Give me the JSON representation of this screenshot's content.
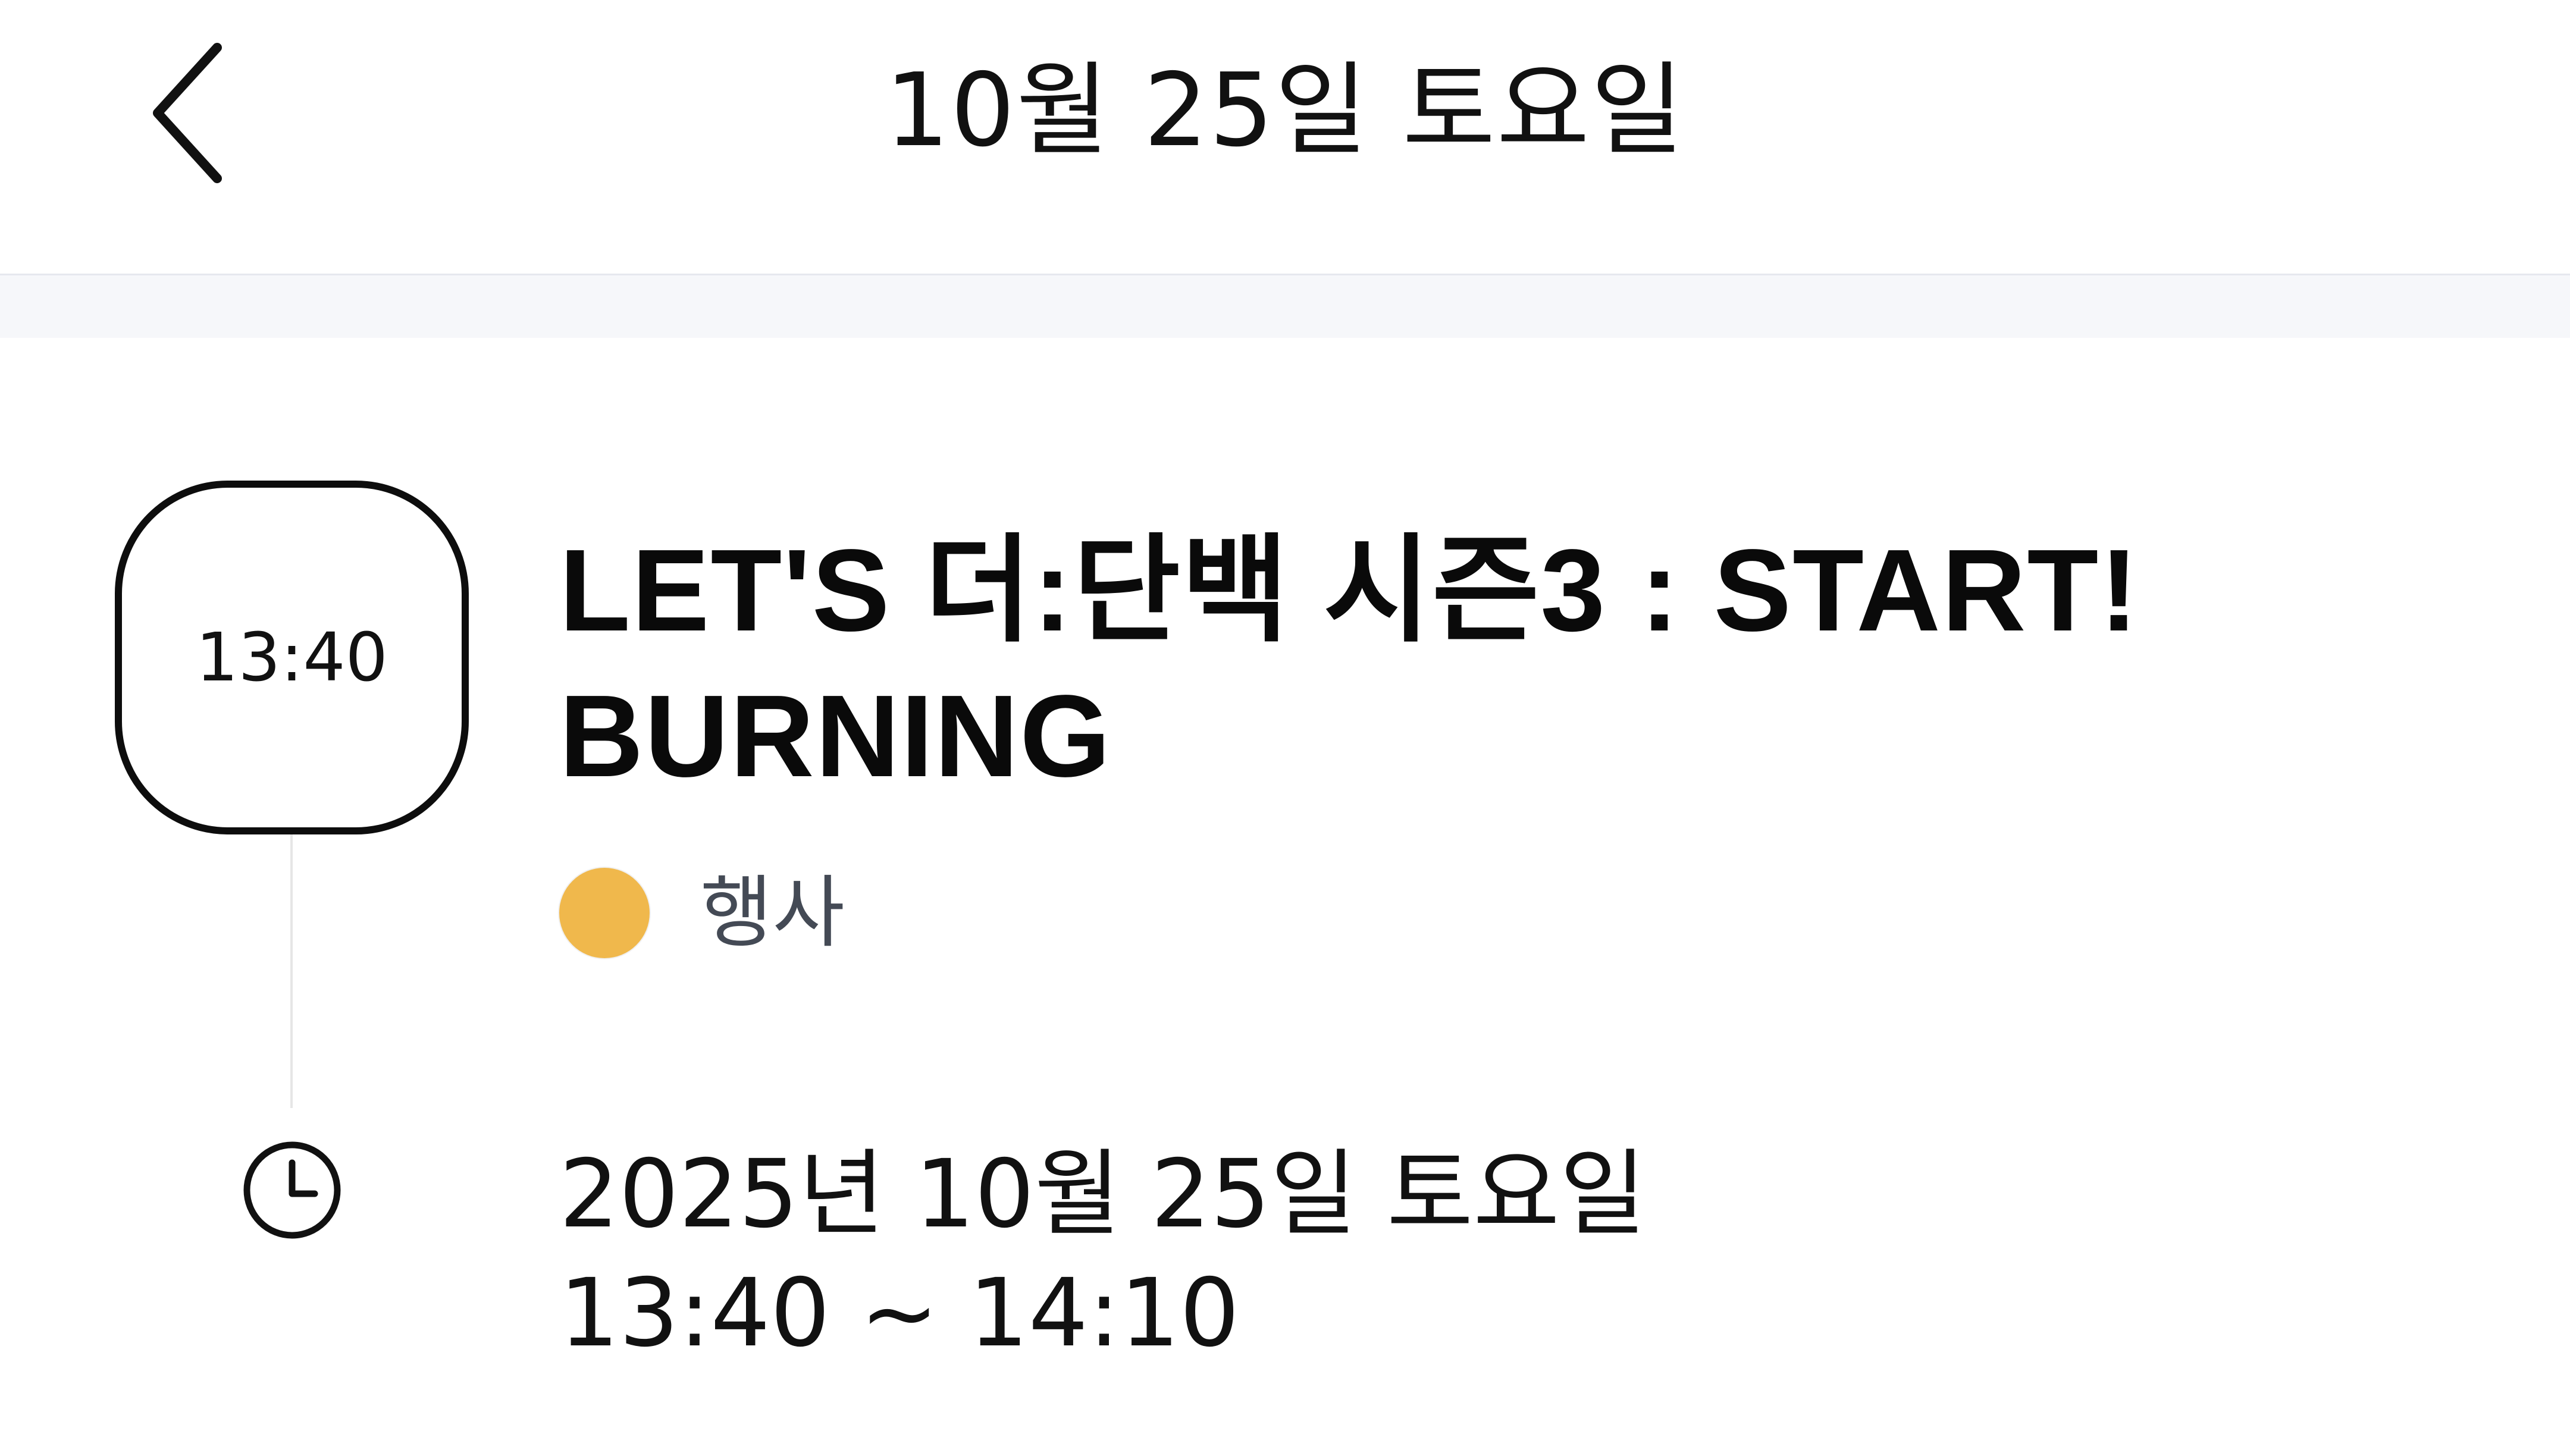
{
  "header": {
    "title": "10월 25일 토요일",
    "back_icon": "chevron-left-icon"
  },
  "event": {
    "time_badge": "13:40",
    "title_line1": "LET'S 더:단백 시즌3 : START!",
    "title_line2": "BURNING",
    "category": {
      "label": "행사",
      "color": "#F0B84C"
    },
    "schedule": {
      "icon": "clock-icon",
      "date": "2025년 10월 25일 토요일",
      "time_range": "13:40 ~ 14:10"
    }
  }
}
